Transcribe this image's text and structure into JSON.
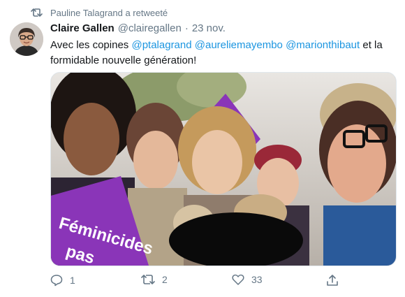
{
  "retweet": {
    "text": "Pauline Talagrand a retweeté",
    "icon": "retweet-icon"
  },
  "tweet": {
    "author_name": "Claire Gallen",
    "handle": "@clairegallen",
    "separator": "·",
    "date": "23 nov.",
    "text_intro": "Avec les copines",
    "mentions": [
      "@ptalagrand",
      "@aureliemayembo",
      "@marionthibaut"
    ],
    "text_outro": "et la formidable nouvelle génération!",
    "media_sign_text": [
      "Féminicides",
      "pas"
    ],
    "actions": {
      "reply_count": "1",
      "retweet_count": "2",
      "like_count": "33"
    }
  },
  "colors": {
    "accent": "#1b95e0",
    "muted": "#657786",
    "sign_purple": "#8a35b8"
  }
}
